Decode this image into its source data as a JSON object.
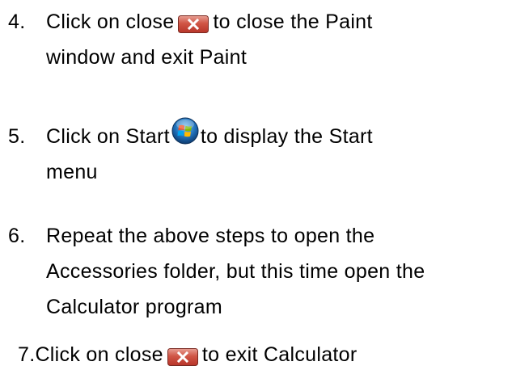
{
  "steps": [
    {
      "number": "4.",
      "line1_before": "Click on close",
      "line1_after": "to close the Paint",
      "line2": "window and exit Paint",
      "icon": "close-icon"
    },
    {
      "number": "5.",
      "line1_before": "Click on Start",
      "line1_after": "to display the Start",
      "line2": "menu",
      "icon": "windows-start-orb-icon"
    },
    {
      "number": "6.",
      "line1": "Repeat the above steps to open the",
      "line2": "Accessories folder, but this time open the",
      "line3": "Calculator program"
    },
    {
      "number": "7.",
      "line1_before": "Click on close",
      "line1_after": "to exit Calculator",
      "icon": "close-icon"
    }
  ],
  "colors": {
    "text": "#000000",
    "close_icon_red": "#c9463c",
    "start_orb_blue": "#1f6fb8"
  }
}
